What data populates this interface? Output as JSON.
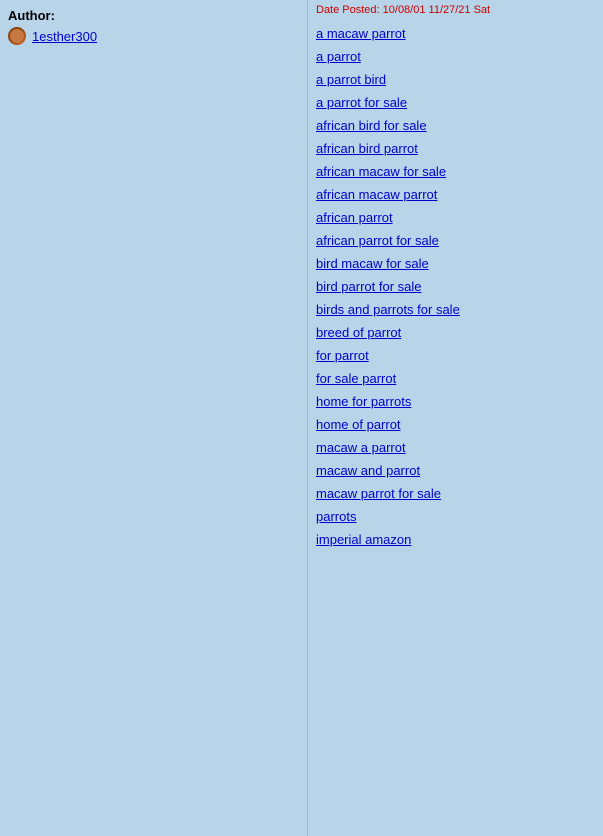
{
  "sidebar": {
    "author_label": "Author:",
    "author_name": "1esther300"
  },
  "main": {
    "date_bar": "Date Posted: 10/08/01 11/27/21 Sat",
    "links": [
      "a macaw parrot",
      "a parrot",
      "a parrot bird",
      "a parrot for sale",
      "african bird for sale",
      "african bird parrot",
      "african macaw for sale",
      "african macaw parrot",
      "african parrot",
      "african parrot for sale",
      "bird macaw for sale",
      "bird parrot for sale",
      "birds and parrots for sale",
      "breed of parrot",
      "for parrot",
      "for sale parrot",
      "home for parrots",
      "home of parrot",
      "macaw a parrot",
      "macaw and parrot",
      "macaw parrot for sale",
      "parrots",
      "imperial amazon"
    ]
  }
}
